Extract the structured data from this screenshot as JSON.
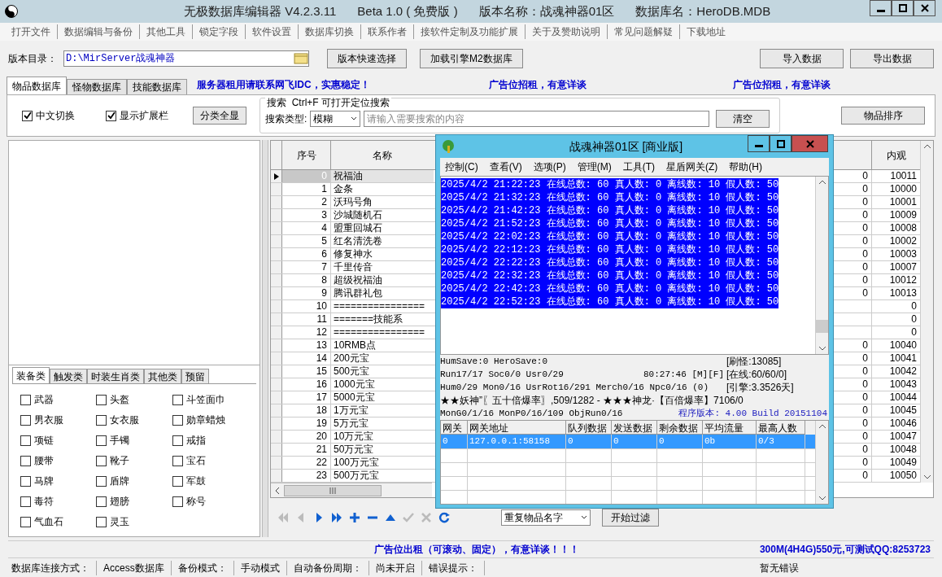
{
  "window": {
    "title": "无极数据库编辑器 V4.2.3.11",
    "edition": "Beta 1.0 ( 免费版 )",
    "version_name": "版本名称：战魂神器01区",
    "database_name": "数据库名：HeroDB.MDB"
  },
  "menu": [
    "打开文件",
    "数据编辑与备份",
    "其他工具",
    "锁定字段",
    "软件设置",
    "数据库切换",
    "联系作者",
    "接软件定制及功能扩展",
    "关于及赞助说明",
    "常见问题解疑",
    "下载地址"
  ],
  "toolbar": {
    "dir_label": "版本目录：",
    "dir_value": "D:\\MirServer战魂神器",
    "buttons": [
      "版本快速选择",
      "加载引擎M2数据库"
    ],
    "right_buttons": [
      "导入数据",
      "导出数据"
    ]
  },
  "tabs": [
    {
      "label": "物品数据库",
      "selected": true
    },
    {
      "label": "怪物数据库",
      "selected": false
    },
    {
      "label": "技能数据库",
      "selected": false
    }
  ],
  "ads": [
    "服务器租用请联系网飞IDC，实惠稳定！",
    "广告位招租，有意详谈",
    "广告位招租，有意详谈"
  ],
  "options": {
    "checkboxes": [
      {
        "label": "中文切换",
        "checked": true
      },
      {
        "label": "显示扩展栏",
        "checked": true
      }
    ],
    "show_all_button": "分类全显",
    "search_title": "搜索  Ctrl+F 可打开定位搜索",
    "search_type_label": "搜索类型:",
    "search_type": "模糊",
    "search_placeholder": "请输入需要搜索的内容",
    "clear_button": "清空",
    "sort_button": "物品排序"
  },
  "category_tabs": [
    {
      "label": "装备类",
      "selected": true
    },
    {
      "label": "触发类",
      "selected": false
    },
    {
      "label": "时装生肖类",
      "selected": false
    },
    {
      "label": "其他类",
      "selected": false
    },
    {
      "label": "预留",
      "selected": false
    }
  ],
  "categories": [
    {
      "label": "武器",
      "checked": false
    },
    {
      "label": "头盔",
      "checked": false
    },
    {
      "label": "斗笠面巾",
      "checked": false
    },
    {
      "label": "男衣服",
      "checked": false
    },
    {
      "label": "女衣服",
      "checked": false
    },
    {
      "label": "勋章蜡烛",
      "checked": false
    },
    {
      "label": "项链",
      "checked": false
    },
    {
      "label": "手镯",
      "checked": false
    },
    {
      "label": "戒指",
      "checked": false
    },
    {
      "label": "腰带",
      "checked": false
    },
    {
      "label": "靴子",
      "checked": false
    },
    {
      "label": "宝石",
      "checked": false
    },
    {
      "label": "马牌",
      "checked": false
    },
    {
      "label": "盾牌",
      "checked": false
    },
    {
      "label": "军鼓",
      "checked": false
    },
    {
      "label": "毒符",
      "checked": false
    },
    {
      "label": "翅膀",
      "checked": false
    },
    {
      "label": "称号",
      "checked": false
    },
    {
      "label": "气血石",
      "checked": false
    },
    {
      "label": "灵玉",
      "checked": false
    }
  ],
  "table": {
    "columns": [
      "序号",
      "名称",
      "内观"
    ],
    "rows": [
      {
        "index": "0",
        "name": "祝福油",
        "column_3": "0",
        "look": "10011",
        "selected": true
      },
      {
        "index": "1",
        "name": "金条",
        "column_3": "0",
        "look": "10000",
        "selected": false
      },
      {
        "index": "2",
        "name": "沃玛号角",
        "column_3": "0",
        "look": "10001",
        "selected": false
      },
      {
        "index": "3",
        "name": "沙城随机石",
        "column_3": "0",
        "look": "10009",
        "selected": false
      },
      {
        "index": "4",
        "name": "盟重回城石",
        "column_3": "0",
        "look": "10008",
        "selected": false
      },
      {
        "index": "5",
        "name": "红名清洗卷",
        "column_3": "0",
        "look": "10002",
        "selected": false
      },
      {
        "index": "6",
        "name": "修复神水",
        "column_3": "0",
        "look": "10003",
        "selected": false
      },
      {
        "index": "7",
        "name": "千里传音",
        "column_3": "0",
        "look": "10007",
        "selected": false
      },
      {
        "index": "8",
        "name": "超级祝福油",
        "column_3": "0",
        "look": "10012",
        "selected": false
      },
      {
        "index": "9",
        "name": "腾讯群礼包",
        "column_3": "0",
        "look": "10013",
        "selected": false
      },
      {
        "index": "10",
        "name": "================",
        "look": "0",
        "selected": false
      },
      {
        "index": "11",
        "name": "=======技能系",
        "look": "0",
        "selected": false
      },
      {
        "index": "12",
        "name": "================",
        "look": "0",
        "selected": false
      },
      {
        "index": "13",
        "name": "10RMB点",
        "column_3": "0",
        "look": "10040",
        "selected": false
      },
      {
        "index": "14",
        "name": "200元宝",
        "column_3": "0",
        "look": "10041",
        "selected": false
      },
      {
        "index": "15",
        "name": "500元宝",
        "column_3": "0",
        "look": "10042",
        "selected": false
      },
      {
        "index": "16",
        "name": "1000元宝",
        "column_3": "0",
        "look": "10043",
        "selected": false
      },
      {
        "index": "17",
        "name": "5000元宝",
        "column_3": "0",
        "look": "10044",
        "selected": false
      },
      {
        "index": "18",
        "name": "1万元宝",
        "column_3": "0",
        "look": "10045",
        "selected": false
      },
      {
        "index": "19",
        "name": "5万元宝",
        "column_3": "0",
        "look": "10046",
        "selected": false
      },
      {
        "index": "20",
        "name": "10万元宝",
        "column_3": "0",
        "look": "10047",
        "selected": false
      },
      {
        "index": "21",
        "name": "50万元宝",
        "column_3": "0",
        "look": "10048",
        "selected": false
      },
      {
        "index": "22",
        "name": "100万元宝",
        "column_3": "0",
        "look": "10049",
        "selected": false
      },
      {
        "index": "23",
        "name": "500万元宝",
        "column_3": "0",
        "look": "10050",
        "selected": false
      }
    ]
  },
  "filter": {
    "select": "重复物品名字",
    "button": "开始过滤"
  },
  "overlay": {
    "title": "战魂神器01区 [商业版]",
    "menu": [
      "控制(C)",
      "查看(V)",
      "选项(P)",
      "管理(M)",
      "工具(T)",
      "星盾网关(Z)",
      "帮助(H)"
    ],
    "log": [
      {
        "text": "2025/4/2 21:22:23 在线总数: 60 真人数: 0 离线数: 10 假人数: 50",
        "selected": true
      },
      {
        "text": "2025/4/2 21:32:23 在线总数: 60 真人数: 0 离线数: 10 假人数: 50",
        "selected": true
      },
      {
        "text": "2025/4/2 21:42:23 在线总数: 60 真人数: 0 离线数: 10 假人数: 50",
        "selected": true
      },
      {
        "text": "2025/4/2 21:52:23 在线总数: 60 真人数: 0 离线数: 10 假人数: 50",
        "selected": true
      },
      {
        "text": "2025/4/2 22:02:23 在线总数: 60 真人数: 0 离线数: 10 假人数: 50",
        "selected": true
      },
      {
        "text": "2025/4/2 22:12:23 在线总数: 60 真人数: 0 离线数: 10 假人数: 50",
        "selected": true
      },
      {
        "text": "2025/4/2 22:22:23 在线总数: 60 真人数: 0 离线数: 10 假人数: 50",
        "selected": true
      },
      {
        "text": "2025/4/2 22:32:23 在线总数: 60 真人数: 0 离线数: 10 假人数: 50",
        "selected": true
      },
      {
        "text": "2025/4/2 22:42:23 在线总数: 60 真人数: 0 离线数: 10 假人数: 50",
        "selected": true
      },
      {
        "text": "2025/4/2 22:52:23 在线总数: 60 真人数: 0 离线数: 10 假人数: 50",
        "selected": true
      }
    ],
    "status": {
      "lines": [
        "HumSave:0 HeroSave:0",
        "Run17/17 Soc0/0 Usr0/29",
        "Hum0/29 Mon0/16 UsrRot16/291 Merch0/16 Npc0/16 (0)",
        "★★妖神”〖五十倍爆率〗,509/1282 - ★★★神龙·【百倍爆率】7106/0",
        "MonG0/1/16 MonP0/16/109 ObjRun0/16"
      ],
      "clock": "80:27:46 [M][F]",
      "counters": [
        "[刷怪:13085]",
        "[在线:60/60/0]",
        "[引擎:3.3526天]"
      ],
      "version": "程序版本: 4.00 Build 20151104"
    },
    "gateway": {
      "columns": [
        "网关",
        "网关地址",
        "队列数据",
        "发送数据",
        "剩余数据",
        "平均流量",
        "最高人数"
      ],
      "rows": [
        {
          "cells": [
            "0",
            "127.0.0.1:58158",
            "0",
            "0",
            "0",
            "0b",
            "0/3"
          ],
          "selected": true
        }
      ]
    }
  },
  "ad_line": "广告位出租（可滚动、固定），有意详谈！！！",
  "ad_right": "300M(4H4G)550元,可测试QQ:8253723",
  "status_bar": [
    {
      "label": "数据库连接方式：",
      "value": "Access数据库"
    },
    {
      "label": "备份模式：",
      "value": "手动模式"
    },
    {
      "label": "自动备份周期：",
      "value": "尚未开启"
    },
    {
      "label": "错误提示：",
      "value": "暂无错误"
    }
  ]
}
